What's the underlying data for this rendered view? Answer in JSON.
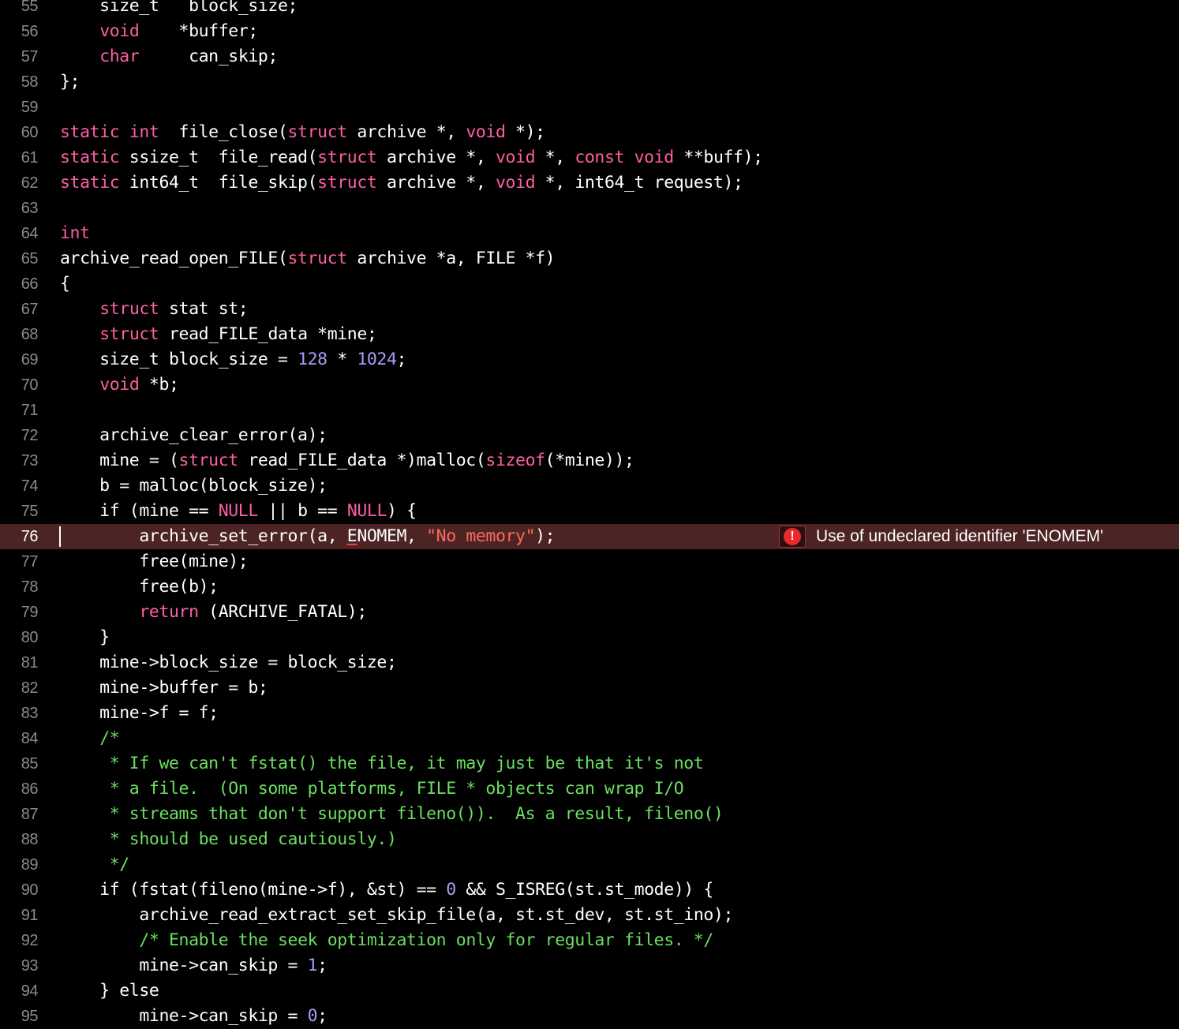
{
  "theme": {
    "background": "#000000",
    "keyword": "#fc5fa3",
    "number": "#a79df7",
    "string": "#fc6a5d",
    "comment": "#6bdf61",
    "plain": "#ffffff",
    "line_number": "#8a8a8a",
    "error_line_bg": "#4d2424"
  },
  "editor": {
    "error_line": 76,
    "issue": {
      "line": 76,
      "icon": "error-icon",
      "icon_glyph": "!",
      "message": "Use of undeclared identifier 'ENOMEM'"
    },
    "lines": [
      {
        "n": "55",
        "t": [
          [
            "p",
            "    size_t   block_size;"
          ]
        ]
      },
      {
        "n": "56",
        "t": [
          [
            "p",
            "    "
          ],
          [
            "k",
            "void"
          ],
          [
            "p",
            "    *buffer;"
          ]
        ]
      },
      {
        "n": "57",
        "t": [
          [
            "p",
            "    "
          ],
          [
            "k",
            "char"
          ],
          [
            "p",
            "     can_skip;"
          ]
        ]
      },
      {
        "n": "58",
        "t": [
          [
            "p",
            "};"
          ]
        ]
      },
      {
        "n": "59",
        "t": []
      },
      {
        "n": "60",
        "t": [
          [
            "k",
            "static"
          ],
          [
            "p",
            " "
          ],
          [
            "k",
            "int"
          ],
          [
            "p",
            "  file_close("
          ],
          [
            "k",
            "struct"
          ],
          [
            "p",
            " archive *, "
          ],
          [
            "k",
            "void"
          ],
          [
            "p",
            " *);"
          ]
        ]
      },
      {
        "n": "61",
        "t": [
          [
            "k",
            "static"
          ],
          [
            "p",
            " ssize_t  file_read("
          ],
          [
            "k",
            "struct"
          ],
          [
            "p",
            " archive *, "
          ],
          [
            "k",
            "void"
          ],
          [
            "p",
            " *, "
          ],
          [
            "k",
            "const"
          ],
          [
            "p",
            " "
          ],
          [
            "k",
            "void"
          ],
          [
            "p",
            " **buff);"
          ]
        ]
      },
      {
        "n": "62",
        "t": [
          [
            "k",
            "static"
          ],
          [
            "p",
            " int64_t  file_skip("
          ],
          [
            "k",
            "struct"
          ],
          [
            "p",
            " archive *, "
          ],
          [
            "k",
            "void"
          ],
          [
            "p",
            " *, int64_t request);"
          ]
        ]
      },
      {
        "n": "63",
        "t": []
      },
      {
        "n": "64",
        "t": [
          [
            "k",
            "int"
          ]
        ]
      },
      {
        "n": "65",
        "t": [
          [
            "p",
            "archive_read_open_FILE("
          ],
          [
            "k",
            "struct"
          ],
          [
            "p",
            " archive *a, FILE *f)"
          ]
        ]
      },
      {
        "n": "66",
        "t": [
          [
            "p",
            "{"
          ]
        ]
      },
      {
        "n": "67",
        "t": [
          [
            "p",
            "    "
          ],
          [
            "k",
            "struct"
          ],
          [
            "p",
            " stat st;"
          ]
        ]
      },
      {
        "n": "68",
        "t": [
          [
            "p",
            "    "
          ],
          [
            "k",
            "struct"
          ],
          [
            "p",
            " read_FILE_data *mine;"
          ]
        ]
      },
      {
        "n": "69",
        "t": [
          [
            "p",
            "    size_t block_size = "
          ],
          [
            "n",
            "128"
          ],
          [
            "p",
            " * "
          ],
          [
            "n",
            "1024"
          ],
          [
            "p",
            ";"
          ]
        ]
      },
      {
        "n": "70",
        "t": [
          [
            "p",
            "    "
          ],
          [
            "k",
            "void"
          ],
          [
            "p",
            " *b;"
          ]
        ]
      },
      {
        "n": "71",
        "t": []
      },
      {
        "n": "72",
        "t": [
          [
            "p",
            "    archive_clear_error(a);"
          ]
        ]
      },
      {
        "n": "73",
        "t": [
          [
            "p",
            "    mine = ("
          ],
          [
            "k",
            "struct"
          ],
          [
            "p",
            " read_FILE_data *)malloc("
          ],
          [
            "k",
            "sizeof"
          ],
          [
            "p",
            "(*mine));"
          ]
        ]
      },
      {
        "n": "74",
        "t": [
          [
            "p",
            "    b = malloc(block_size);"
          ]
        ]
      },
      {
        "n": "75",
        "t": [
          [
            "p",
            "    if (mine == "
          ],
          [
            "k",
            "NULL"
          ],
          [
            "p",
            " || b == "
          ],
          [
            "k",
            "NULL"
          ],
          [
            "p",
            ") {"
          ]
        ]
      },
      {
        "n": "76",
        "t": [
          [
            "p",
            "        archive_set_error(a, "
          ],
          [
            "u",
            "E"
          ],
          [
            "p",
            "NOMEM, "
          ],
          [
            "s",
            "\"No memory\""
          ],
          [
            "p",
            ");"
          ]
        ]
      },
      {
        "n": "77",
        "t": [
          [
            "p",
            "        free(mine);"
          ]
        ]
      },
      {
        "n": "78",
        "t": [
          [
            "p",
            "        free(b);"
          ]
        ]
      },
      {
        "n": "79",
        "t": [
          [
            "p",
            "        "
          ],
          [
            "k",
            "return"
          ],
          [
            "p",
            " (ARCHIVE_FATAL);"
          ]
        ]
      },
      {
        "n": "80",
        "t": [
          [
            "p",
            "    }"
          ]
        ]
      },
      {
        "n": "81",
        "t": [
          [
            "p",
            "    mine->block_size = block_size;"
          ]
        ]
      },
      {
        "n": "82",
        "t": [
          [
            "p",
            "    mine->buffer = b;"
          ]
        ]
      },
      {
        "n": "83",
        "t": [
          [
            "p",
            "    mine->f = f;"
          ]
        ]
      },
      {
        "n": "84",
        "t": [
          [
            "p",
            "    "
          ],
          [
            "c",
            "/*"
          ]
        ]
      },
      {
        "n": "85",
        "t": [
          [
            "c",
            "     * If we can't fstat() the file, it may just be that it's not"
          ]
        ]
      },
      {
        "n": "86",
        "t": [
          [
            "c",
            "     * a file.  (On some platforms, FILE * objects can wrap I/O"
          ]
        ]
      },
      {
        "n": "87",
        "t": [
          [
            "c",
            "     * streams that don't support fileno()).  As a result, fileno()"
          ]
        ]
      },
      {
        "n": "88",
        "t": [
          [
            "c",
            "     * should be used cautiously.)"
          ]
        ]
      },
      {
        "n": "89",
        "t": [
          [
            "c",
            "     */"
          ]
        ]
      },
      {
        "n": "90",
        "t": [
          [
            "p",
            "    if (fstat(fileno(mine->f), &st) == "
          ],
          [
            "n",
            "0"
          ],
          [
            "p",
            " && S_ISREG(st.st_mode)) {"
          ]
        ]
      },
      {
        "n": "91",
        "t": [
          [
            "p",
            "        archive_read_extract_set_skip_file(a, st.st_dev, st.st_ino);"
          ]
        ]
      },
      {
        "n": "92",
        "t": [
          [
            "p",
            "        "
          ],
          [
            "c",
            "/* Enable the seek optimization only for regular files. */"
          ]
        ]
      },
      {
        "n": "93",
        "t": [
          [
            "p",
            "        mine->can_skip = "
          ],
          [
            "n",
            "1"
          ],
          [
            "p",
            ";"
          ]
        ]
      },
      {
        "n": "94",
        "t": [
          [
            "p",
            "    } else"
          ]
        ]
      },
      {
        "n": "95",
        "t": [
          [
            "p",
            "        mine->can_skip = "
          ],
          [
            "n",
            "0"
          ],
          [
            "p",
            ";"
          ]
        ]
      }
    ]
  }
}
